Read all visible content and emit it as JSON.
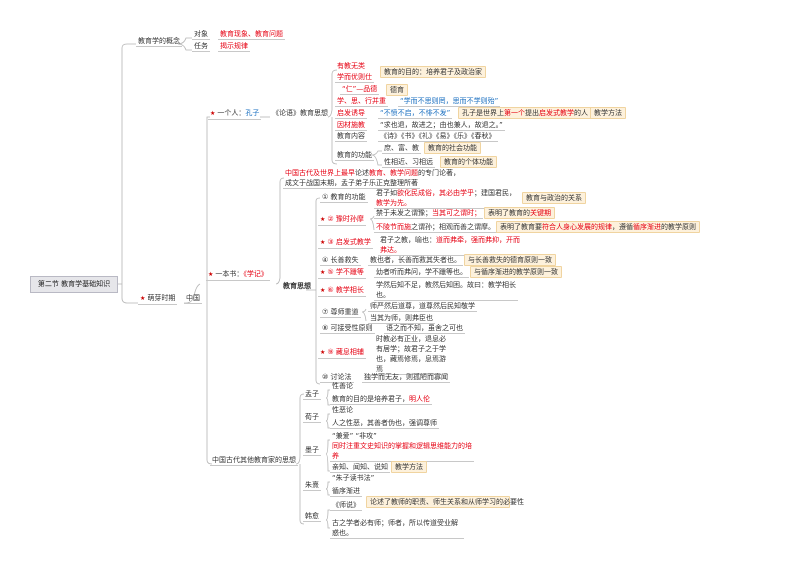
{
  "root": "第二节 教育学基础知识",
  "concept": {
    "label": "教育学的概念",
    "object": "对象",
    "object_val": "教育现象、教育问题",
    "task": "任务",
    "task_val": "揭示规律"
  },
  "sprout": {
    "label": "萌芽时期",
    "china": "中国"
  },
  "confucius": {
    "prefix": "一个人：",
    "name": "孔子",
    "book": "《论语》教育思想",
    "items": [
      {
        "label": "有教无类"
      },
      {
        "label": "学而优则仕",
        "note": "教育的目的：培养君子及政治家"
      },
      {
        "label": "“仁”—品德",
        "note": "德育"
      },
      {
        "label": "学、思、行并重",
        "quote": "“学而不思则罔，思而不学则殆”"
      },
      {
        "label": "启发诱导",
        "quote": "“不愤不启，不悱不发”",
        "note_a": "孔子是世界上",
        "note_b": "第一个",
        "note_c": "提出",
        "note_d": "启发式教学",
        "note_e": "的人",
        "note2": "教学方法"
      },
      {
        "label": "因材施教",
        "quote": "“求也退，故进之；由也兼人，故退之。”"
      },
      {
        "label": "教育内容",
        "quote": "《诗》《书》《礼》《易》《乐》《春秋》"
      },
      {
        "label": "教育的功能",
        "sub1": "庶、富、教",
        "sub1_note": "教育的社会功能",
        "sub2": "性相近、习相远",
        "sub2_note": "教育的个体功能"
      }
    ]
  },
  "xueji": {
    "prefix": "一本书：",
    "name": "《学记》",
    "thought": "教育思想",
    "intro_a": "中国古代及世界上最早",
    "intro_b": "论述",
    "intro_c": "教育、教学问题",
    "intro_d": "的专门论著，",
    "intro2": "成文于战国末期，孟子弟子乐正克整理所著",
    "items": [
      {
        "label": "① 教育的功能",
        "t1": "君子如",
        "t2": "欲化民成俗，其必由学乎",
        "t3": "；建国君民，",
        "t4": "教学为先。",
        "note": "教育与政治的关系"
      },
      {
        "label": "② 豫时孙摩",
        "l1a": "禁于未发之谓豫；",
        "l1b": "当其可之谓时；",
        "note1a": "表明了教育的",
        "note1b": "关键期",
        "l2a": "不陵节而施",
        "l2b": "之谓孙；相观而善之谓摩。",
        "note2a": "表明了教育要",
        "note2b": "符合人身心发展的规律",
        "note2c": "，遵循",
        "note2d": "循序渐进",
        "note2e": "的教学原则"
      },
      {
        "label": "③ 启发式教学",
        "t1": "君子之教，喻也：",
        "t2": "道而弗牵，强而弗抑，开而弗达。"
      },
      {
        "label": "④ 长善救失",
        "t1": "教也者，长善而救其失者也。",
        "note": "与长善救失的德育原则一致"
      },
      {
        "label": "⑤ 学不躐等",
        "t1": "幼者听而弗问，学不躐等也。",
        "note": "与循序渐进的教学原则一致"
      },
      {
        "label": "⑥ 教学相长",
        "t1": "学然后知不足，教然后知困。故曰：教学相长也。"
      },
      {
        "label": "⑦ 尊师重道",
        "t1": "师严然后道尊，道尊然后民知敬学",
        "t2": "当其为师，则弗臣也"
      },
      {
        "label": "⑧ 可接受性原则",
        "t1": "语之而不知，虽舍之可也"
      },
      {
        "label": "⑨ 藏息相辅",
        "t1": "时教必有正业，退息必有居学；故君子之于学也，藏焉修焉，息焉游焉"
      },
      {
        "label": "⑩ 讨论法",
        "t1": "独学而无友，则孤陋而寡闻"
      }
    ]
  },
  "others": {
    "label": "中国古代其他教育家的思想",
    "mencius": {
      "label": "孟子",
      "t1": "性善论",
      "t2a": "教育的目的是培养君子，",
      "t2b": "明人伦"
    },
    "xunzi": {
      "label": "荀子",
      "t1": "性恶论",
      "t2": "人之性恶，其善者伪也，强调尊师"
    },
    "mozi": {
      "label": "墨子",
      "t1": "“兼爱”  “非攻”",
      "t2": "同时注重文史知识的掌握和逻辑思维能力的培养",
      "t3": "亲知、闻知、说知",
      "note": "教学方法"
    },
    "zhuxi": {
      "label": "朱熹",
      "t1": "“朱子读书法”",
      "t2": "循序渐进"
    },
    "hanyu": {
      "label": "韩愈",
      "t1": "《师说》",
      "note": "论述了教师的职责、师生关系和从师学习的必要性",
      "t2": "古之学者必有师；师者，所以传道受业解惑也。"
    }
  },
  "colors": {
    "accent_red": "#e60012",
    "quote_blue": "#1a6fc0",
    "note_bg": "#fdf1dc"
  }
}
